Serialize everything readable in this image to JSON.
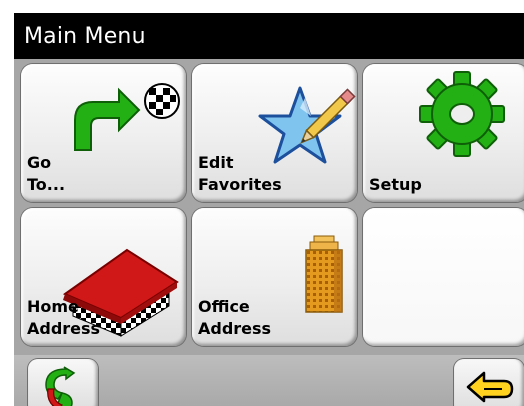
{
  "header": {
    "title": "Main Menu"
  },
  "tiles": [
    {
      "name": "go-to",
      "line1": "Go",
      "line2": "To...",
      "icon": "turn-arrow-checkered-flag-icon"
    },
    {
      "name": "edit-favorites",
      "line1": "Edit",
      "line2": "Favorites",
      "icon": "star-pencil-icon"
    },
    {
      "name": "setup",
      "line1": "Setup",
      "icon": "gear-icon"
    },
    {
      "name": "home-address",
      "line1": "Home",
      "line2": "Address",
      "icon": "house-icon"
    },
    {
      "name": "office-address",
      "line1": "Office",
      "line2": "Address",
      "icon": "office-building-icon"
    },
    {
      "name": "empty",
      "icon": ""
    }
  ],
  "bottom": {
    "left_icon": "route-swap-icon",
    "right_icon": "back-arrow-icon"
  },
  "colors": {
    "green": "#22b014",
    "star_blue": "#7fc4ef",
    "roof_red": "#d01818",
    "building_orange": "#e39a1e",
    "back_yellow": "#ffd21f"
  }
}
